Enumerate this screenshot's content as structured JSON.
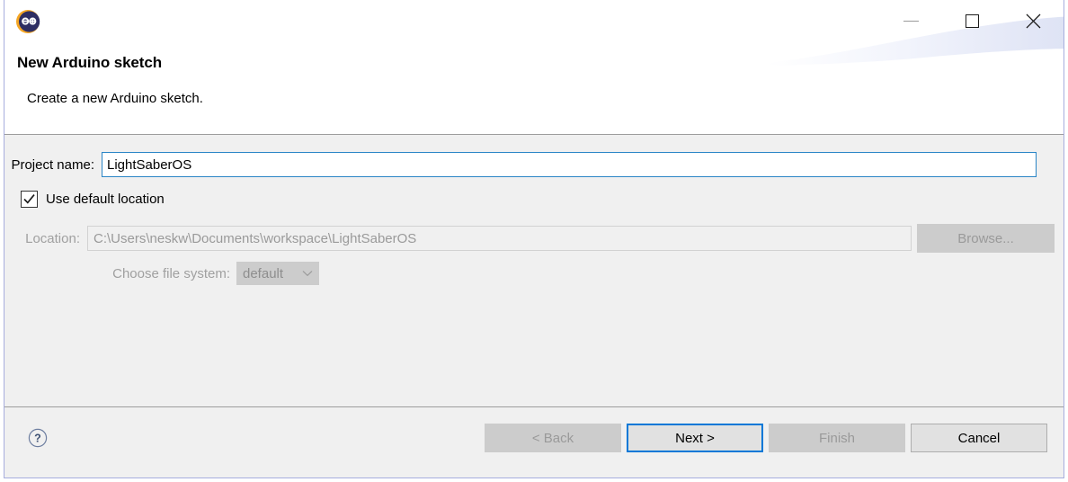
{
  "window": {
    "app_icon": "arduino-logo-icon",
    "controls": {
      "minimize": "minimize-icon",
      "maximize": "maximize-icon",
      "close": "close-icon"
    }
  },
  "header": {
    "title": "New Arduino sketch",
    "description": "Create a new Arduino sketch."
  },
  "form": {
    "project_name": {
      "label": "Project name:",
      "value": "LightSaberOS"
    },
    "use_default_location": {
      "label": "Use default location",
      "checked": true
    },
    "location": {
      "label": "Location:",
      "value": "C:\\Users\\neskw\\Documents\\workspace\\LightSaberOS",
      "browse_label": "Browse...",
      "disabled": true
    },
    "file_system": {
      "label": "Choose file system:",
      "selected": "default",
      "options": [
        "default"
      ],
      "disabled": true
    }
  },
  "footer": {
    "help_label": "?",
    "buttons": {
      "back": "< Back",
      "next": "Next >",
      "finish": "Finish",
      "cancel": "Cancel"
    }
  },
  "colors": {
    "window_border": "#a7aede",
    "body_bg": "#f0f0f0",
    "header_bg": "#ffffff",
    "focus_border": "#2a85c6",
    "default_button_border": "#0078d7",
    "disabled_text": "#9a9a9a",
    "accent_banner": "#dfe3f5",
    "arduino_teal": "#2d2d66",
    "arduino_orange": "#f5a623",
    "help_icon": "#45587a"
  }
}
